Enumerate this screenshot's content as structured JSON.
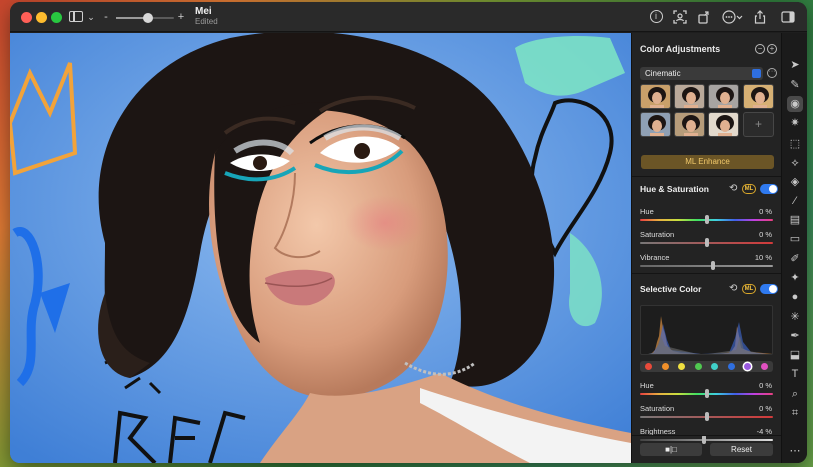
{
  "window": {
    "title": "Mei",
    "subtitle": "Edited"
  },
  "toolbar": {
    "zoom_minus": "-",
    "zoom_plus": "+",
    "zoom_level": 0.55
  },
  "panel": {
    "title": "Color Adjustments",
    "preset_value": "Cinematic",
    "presets_count": 7,
    "add_preset": "+",
    "ml_enhance_label": "ML Enhance",
    "hue_saturation": {
      "title": "Hue & Saturation",
      "ml_badge": "ML",
      "enabled": true,
      "sliders": [
        {
          "label": "Hue",
          "value": "0 %",
          "position": 0.5
        },
        {
          "label": "Saturation",
          "value": "0 %",
          "position": 0.5
        },
        {
          "label": "Vibrance",
          "value": "10 %",
          "position": 0.55
        }
      ]
    },
    "selective_color": {
      "title": "Selective Color",
      "ml_badge": "ML",
      "enabled": true,
      "swatches": [
        "#e84a3a",
        "#f0902a",
        "#f0e040",
        "#50c850",
        "#40d0c8",
        "#2f6fe0",
        "#9a5ae0",
        "#e050c0"
      ],
      "selected_swatch": 6,
      "sliders": [
        {
          "label": "Hue",
          "value": "0 %",
          "position": 0.5
        },
        {
          "label": "Saturation",
          "value": "0 %",
          "position": 0.5
        },
        {
          "label": "Brightness",
          "value": "-4 %",
          "position": 0.48
        }
      ]
    },
    "footer": {
      "compare_label": "■|□",
      "reset_label": "Reset"
    }
  },
  "colors": {
    "accent": "#2f7af0",
    "ml_gold": "#f1c96a",
    "ml_bg": "#6b5526"
  },
  "icons": {
    "toolbar_right": [
      "info-icon",
      "face-scan-icon",
      "rotate-icon",
      "more-icon",
      "share-icon",
      "sidebar-icon"
    ],
    "tools": [
      "pointer-icon",
      "style-transfer-icon",
      "color-adjust-icon",
      "light-icon",
      "selection-icon",
      "smart-select-icon",
      "quick-select-icon",
      "brush-icon",
      "fill-icon",
      "eraser-icon",
      "retouch-icon",
      "clone-icon",
      "blur-icon",
      "sparkle-icon",
      "pen-icon",
      "shapes-icon",
      "text-icon",
      "zoom-icon",
      "crop-icon",
      "more-tools-icon"
    ]
  }
}
